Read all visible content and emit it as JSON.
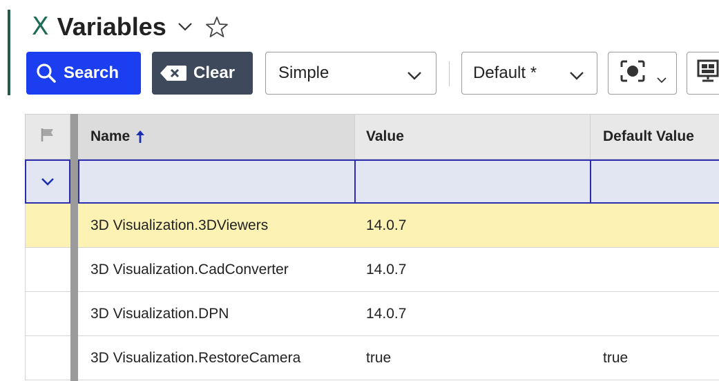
{
  "header": {
    "title_icon": "variables-x-icon",
    "title": "Variables",
    "accent_color": "#1f5d4a"
  },
  "toolbar": {
    "search_label": "Search",
    "clear_label": "Clear",
    "mode_selected": "Simple",
    "view_selected": "Default *",
    "search_color": "#1b3ef0",
    "clear_color": "#3e4a5c"
  },
  "grid": {
    "columns": [
      "Name",
      "Value",
      "Default Value"
    ],
    "sort_column": "Name",
    "sort_direction": "ascending",
    "rows": [
      {
        "name": "3D Visualization.3DViewers",
        "value": "14.0.7",
        "default": "",
        "selected": true
      },
      {
        "name": "3D Visualization.CadConverter",
        "value": "14.0.7",
        "default": ""
      },
      {
        "name": "3D Visualization.DPN",
        "value": "14.0.7",
        "default": ""
      },
      {
        "name": "3D Visualization.RestoreCamera",
        "value": "true",
        "default": "true"
      }
    ],
    "selected_row_color": "#fcf2b3",
    "filter_row_color": "#e2e6f3"
  }
}
